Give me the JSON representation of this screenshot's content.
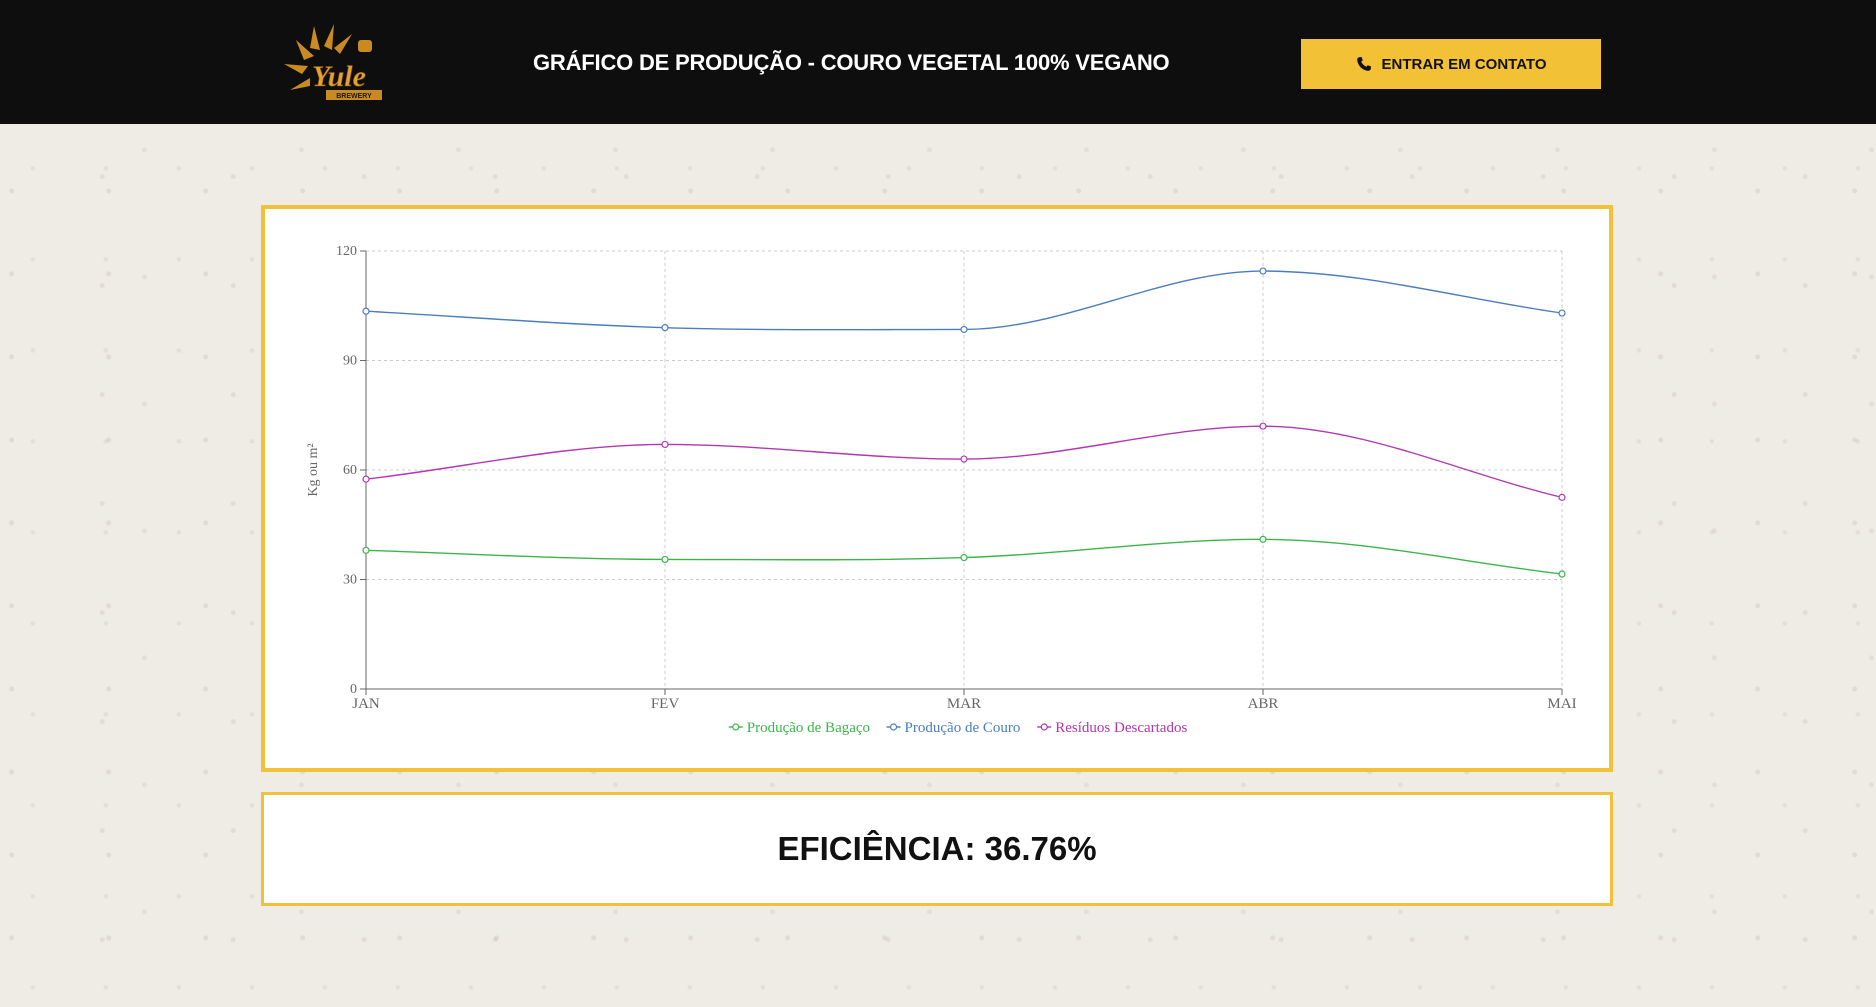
{
  "header": {
    "logo_text": "Yule",
    "logo_subtext": "BREWERY",
    "title": "GRÁFICO DE PRODUÇÃO - COURO VEGETAL 100% VEGANO",
    "contact_button": {
      "label": "ENTRAR EM CONTATO",
      "icon": "phone-icon"
    }
  },
  "colors": {
    "header_bg": "#0e0e0e",
    "accent": "#f0c139",
    "page_bg": "#efece6"
  },
  "chart_data": {
    "type": "line",
    "categories": [
      "JAN",
      "FEV",
      "MAR",
      "ABR",
      "MAI"
    ],
    "ylabel": "Kg ou m²",
    "ylim": [
      0,
      120
    ],
    "yticks": [
      0,
      30,
      60,
      90,
      120
    ],
    "grid": true,
    "legend_position": "bottom",
    "series": [
      {
        "name": "Produção de Bagaço",
        "color": "#3bb54a",
        "values": [
          38,
          35.5,
          36,
          41,
          31.5
        ]
      },
      {
        "name": "Produção de Couro",
        "color": "#4a7dbf",
        "values": [
          103.5,
          99,
          98.5,
          114.5,
          103
        ]
      },
      {
        "name": "Resíduos Descartados",
        "color": "#b237b2",
        "values": [
          57.5,
          67,
          63,
          72,
          52.5
        ]
      }
    ]
  },
  "efficiency": {
    "text": "EFICIÊNCIA: 36.76%"
  }
}
